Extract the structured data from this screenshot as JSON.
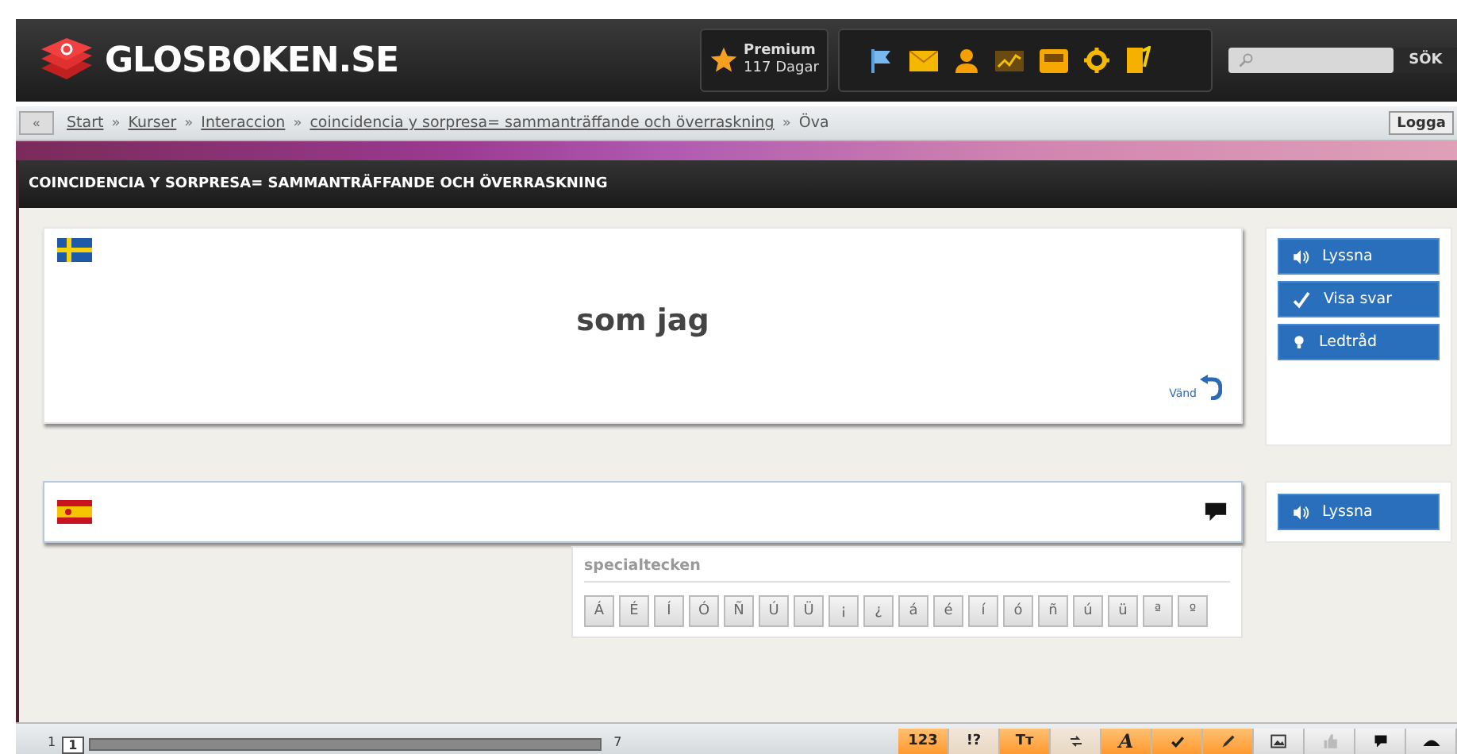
{
  "header": {
    "logo": "GLOSBOKEN.SE",
    "premium": {
      "title": "Premium",
      "days": "117 Dagar"
    },
    "search": {
      "button": "SÖK"
    }
  },
  "breadcrumb": {
    "back": "«",
    "separator": "»",
    "items": [
      {
        "label": "Start",
        "link": true
      },
      {
        "label": "Kurser",
        "link": true
      },
      {
        "label": "Interaccion",
        "link": true
      },
      {
        "label": "coincidencia y sorpresa= sammanträffande och överraskning",
        "link": true
      },
      {
        "label": "Öva",
        "link": false
      }
    ],
    "logout": "Logga"
  },
  "title": "COINCIDENCIA Y SORPRESA= SAMMANTRÄFFANDE OCH ÖVERRASKNING",
  "question": {
    "word": "som jag",
    "flip": "Vänd",
    "actions": [
      {
        "kind": "listen",
        "label": "Lyssna"
      },
      {
        "kind": "answer",
        "label": "Visa svar"
      },
      {
        "kind": "hint",
        "label": "Ledtråd"
      }
    ]
  },
  "answer": {
    "actions": [
      {
        "kind": "listen",
        "label": "Lyssna"
      }
    ]
  },
  "special_chars": {
    "title": "specialtecken",
    "chars": [
      "Á",
      "É",
      "Í",
      "Ó",
      "Ñ",
      "Ú",
      "Ü",
      "¡",
      "¿",
      "á",
      "é",
      "í",
      "ó",
      "ñ",
      "ú",
      "ü",
      "ª",
      "º"
    ]
  },
  "progress": {
    "start": "1",
    "current": "1",
    "end": "7"
  },
  "toolbar": [
    {
      "kind": "text",
      "label": "123",
      "on": true
    },
    {
      "kind": "text",
      "label": "!?",
      "on": false
    },
    {
      "kind": "text",
      "label": "Tт",
      "on": true
    },
    {
      "kind": "swap",
      "on": false
    },
    {
      "kind": "text",
      "label": "A",
      "on": true
    },
    {
      "kind": "check",
      "on": true
    },
    {
      "kind": "pencil",
      "on": true
    },
    {
      "kind": "image"
    },
    {
      "kind": "thumb"
    },
    {
      "kind": "speech"
    },
    {
      "kind": "hat"
    }
  ]
}
